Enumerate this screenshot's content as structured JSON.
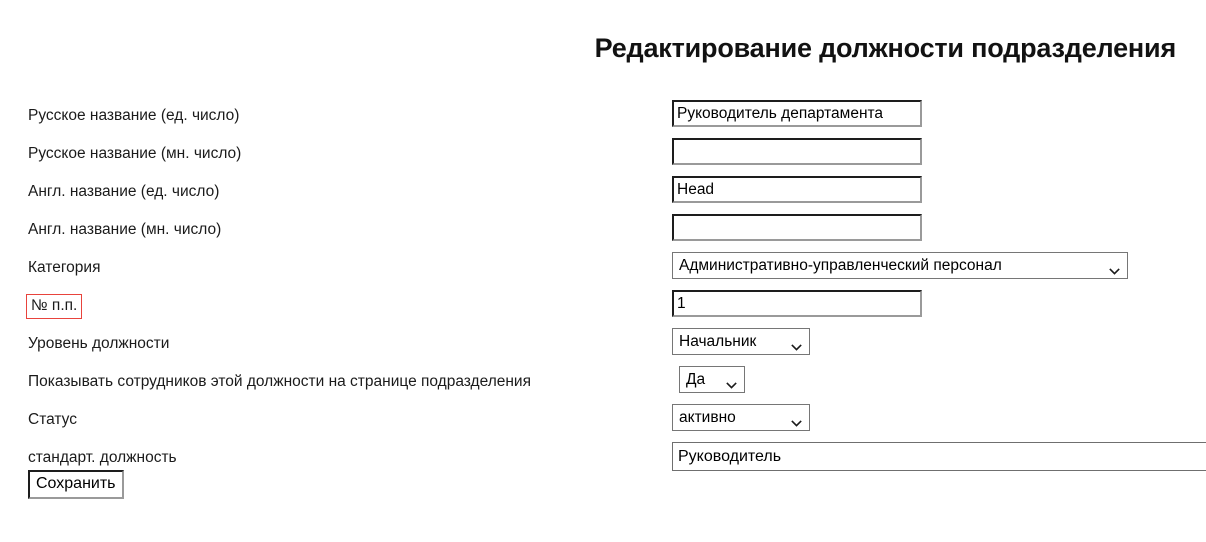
{
  "page": {
    "title": "Редактирование должности подразделения"
  },
  "form": {
    "rows": [
      {
        "label": "Русское название (ед. число)",
        "control": "text",
        "value": "Руководитель департамента",
        "placeholder": ""
      },
      {
        "label": "Русское название (мн. число)",
        "control": "text",
        "value": "",
        "placeholder": ""
      },
      {
        "label": "Англ. название (ед. число)",
        "control": "text",
        "value": "Head",
        "placeholder": ""
      },
      {
        "label": "Англ. название (мн. число)",
        "control": "text",
        "value": "",
        "placeholder": ""
      },
      {
        "label": "Категория",
        "control": "select",
        "value": "Административно-управленческий персонал"
      },
      {
        "label": "№ п.п.",
        "control": "text",
        "value": "1",
        "placeholder": "",
        "highlighted": true
      },
      {
        "label": "Уровень должности",
        "control": "select",
        "value": "Начальник"
      },
      {
        "label": "Показывать сотрудников этой должности на странице подразделения",
        "control": "select",
        "value": "Да"
      },
      {
        "label": "Статус",
        "control": "select",
        "value": "активно"
      },
      {
        "label": "стандарт. должность",
        "control": "text",
        "value": "Руководитель",
        "placeholder": ""
      }
    ]
  },
  "actions": {
    "save_label": "Сохранить"
  },
  "icons": {
    "chevron_down": "chevron-down-icon"
  },
  "colors": {
    "highlight_box": "#e8433c",
    "text": "#1b1b1b",
    "input_border_dark": "#1d1d1d",
    "input_border_light": "#9a9a9a",
    "select_border": "#767676",
    "background": "#ffffff"
  }
}
